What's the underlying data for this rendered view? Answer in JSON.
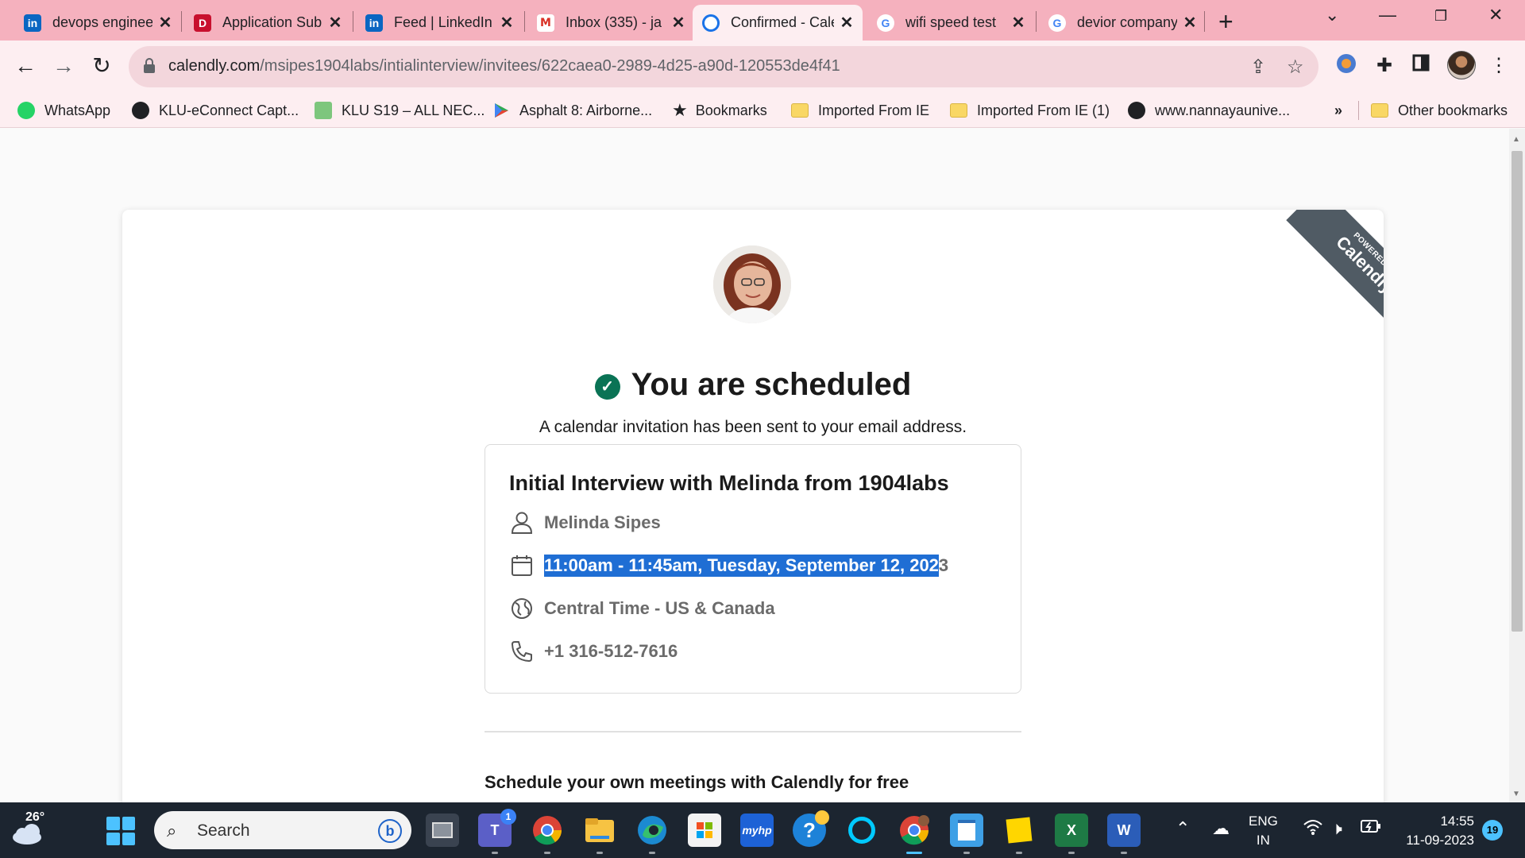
{
  "browser": {
    "tabs": [
      {
        "title": "devops engineer",
        "icon": "linkedin-icon",
        "badge": "in"
      },
      {
        "title": "Application Submitted",
        "icon": "application-icon",
        "badge": "D"
      },
      {
        "title": "Feed | LinkedIn",
        "icon": "linkedin-icon",
        "badge": "in"
      },
      {
        "title": "Inbox (335) - ja",
        "icon": "gmail-icon",
        "badge": "M"
      },
      {
        "title": "Confirmed - Calendly",
        "icon": "calendly-icon",
        "badge": ""
      },
      {
        "title": "wifi speed test",
        "icon": "google-icon",
        "badge": "G"
      },
      {
        "title": "devior company",
        "icon": "google-icon",
        "badge": "G"
      }
    ],
    "active_tab": 4,
    "url_domain": "calendly.com",
    "url_path": "/msipes1904labs/intialinterview/invitees/622caea0-2989-4d25-a90d-120553de4f41",
    "bookmarks": [
      {
        "label": "WhatsApp",
        "icon": "whatsapp-icon"
      },
      {
        "label": "KLU-eConnect Capt...",
        "icon": "globe-icon"
      },
      {
        "label": "KLU S19 – ALL NEC...",
        "icon": "klu-icon"
      },
      {
        "label": "Asphalt 8: Airborne...",
        "icon": "play-store-icon"
      },
      {
        "label": "Bookmarks",
        "icon": "star-icon"
      },
      {
        "label": "Imported From IE",
        "icon": "folder-icon"
      },
      {
        "label": "Imported From IE (1)",
        "icon": "folder-icon"
      },
      {
        "label": "www.nannayaunive...",
        "icon": "globe-icon"
      }
    ],
    "overflow": "»",
    "other_bookmarks": "Other bookmarks"
  },
  "page": {
    "ribbon_small": "POWERED BY",
    "ribbon_brand": "Calendly",
    "headline": "You are scheduled",
    "subline": "A calendar invitation has been sent to your email address.",
    "event_title": "Initial Interview with Melinda from 1904labs",
    "host": "Melinda Sipes",
    "datetime_selected": "11:00am - 11:45am, Tuesday, September 12, 202",
    "datetime_rest": "3",
    "timezone": "Central Time - US & Canada",
    "phone": "+1 316-512-7616",
    "promo": "Schedule your own meetings with Calendly for free"
  },
  "taskbar": {
    "temperature": "26°",
    "search_placeholder": "Search",
    "teams_badge": "1",
    "apps": [
      "task-view-icon",
      "teams-icon",
      "chrome-icon",
      "file-explorer-icon",
      "edge-icon",
      "store-icon",
      "myhp-icon",
      "help-icon",
      "alexa-icon",
      "chrome-profile-icon",
      "notepad-icon",
      "sticky-notes-icon",
      "excel-icon",
      "word-icon"
    ],
    "lang_top": "ENG",
    "lang_bottom": "IN",
    "time": "14:55",
    "date": "11-09-2023",
    "notifications": "19"
  },
  "colors": {
    "tab_strip": "#f5b1be",
    "toolbar": "#fdeef1",
    "selection": "#1f6ed4",
    "check": "#0a7355",
    "ribbon": "#505b64"
  }
}
